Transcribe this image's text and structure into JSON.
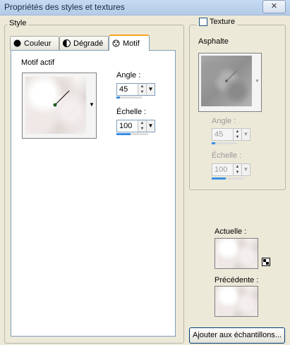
{
  "window": {
    "title": "Propriétés des styles et textures",
    "close_label": "✕"
  },
  "style_group": {
    "label": "Style"
  },
  "tabs": [
    {
      "label": "Couleur",
      "icon": "filled-circle-icon"
    },
    {
      "label": "Dégradé",
      "icon": "half-circle-icon"
    },
    {
      "label": "Motif",
      "icon": "pattern-icon",
      "active": true
    }
  ],
  "motif": {
    "current_label": "Motif actif",
    "angle_label": "Angle :",
    "angle_value": "45",
    "angle_fraction": 0.125,
    "scale_label": "Échelle :",
    "scale_value": "100",
    "scale_fraction": 0.45
  },
  "texture": {
    "checkbox_label": "Texture",
    "checked": false,
    "name": "Asphalte",
    "angle_label": "Angle :",
    "angle_value": "45",
    "scale_label": "Échelle :",
    "scale_value": "100"
  },
  "preview": {
    "current_label": "Actuelle :",
    "previous_label": "Précédente :"
  },
  "buttons": {
    "add_to_swatches": "Ajouter aux échantillons..."
  }
}
